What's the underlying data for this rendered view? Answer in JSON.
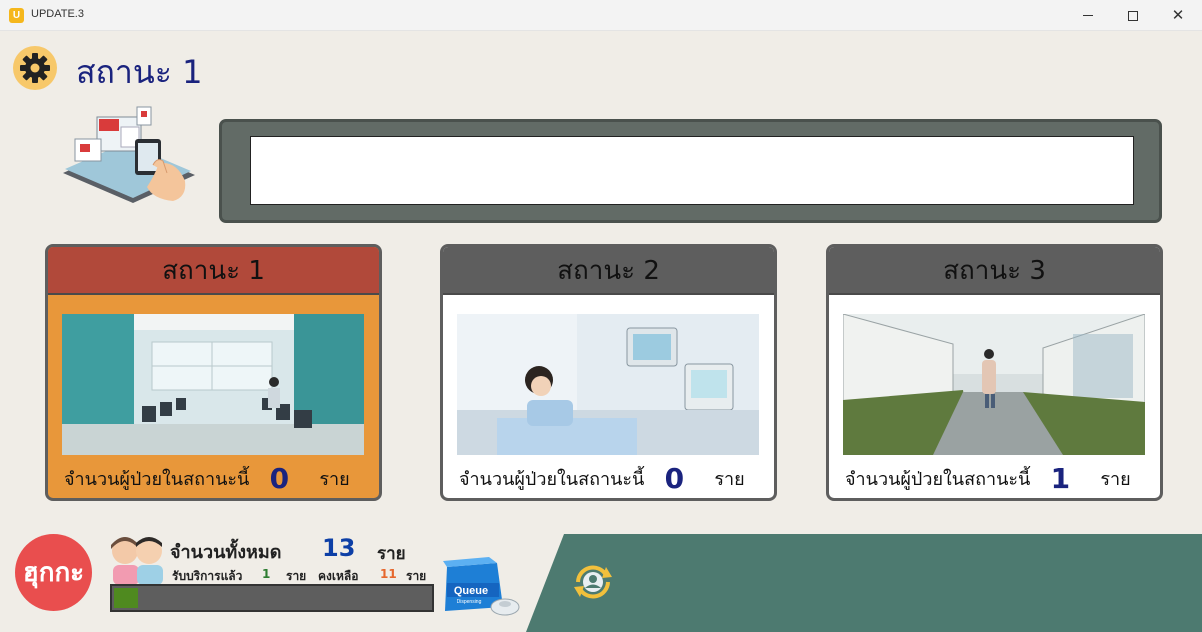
{
  "window": {
    "title": "UPDATE.3",
    "icon_letter": "U"
  },
  "header": {
    "title": "สถานะ 1",
    "settings_icon": "gear-icon"
  },
  "marquee": {
    "text": ""
  },
  "stations": [
    {
      "title": "สถานะ 1",
      "label": "จำนวนผู้ป่วยในสถานะนี้",
      "count": "0",
      "unit": "ราย",
      "active": true,
      "color": "#b1493a"
    },
    {
      "title": "สถานะ 2",
      "label": "จำนวนผู้ป่วยในสถานะนี้",
      "count": "0",
      "unit": "ราย",
      "active": false
    },
    {
      "title": "สถานะ 3",
      "label": "จำนวนผู้ป่วยในสถานะนี้",
      "count": "1",
      "unit": "ราย",
      "active": false
    }
  ],
  "summary": {
    "logo_text": "ฮุกกะ",
    "total_label": "จำนวนทั้งหมด",
    "total_count": "13",
    "total_unit": "ราย",
    "served_label": "รับบริการแล้ว",
    "served_count": "1",
    "served_unit": "ราย",
    "remaining_label": "คงเหลือ",
    "remaining_count": "11",
    "remaining_unit": "ราย",
    "progress_fraction": 0.077,
    "queue_label": "Queue",
    "queue_sublabel": "Dispensing"
  },
  "colors": {
    "accent_orange": "#e8973a",
    "teal_band": "#4d7a70",
    "count_blue": "#1a237e"
  }
}
